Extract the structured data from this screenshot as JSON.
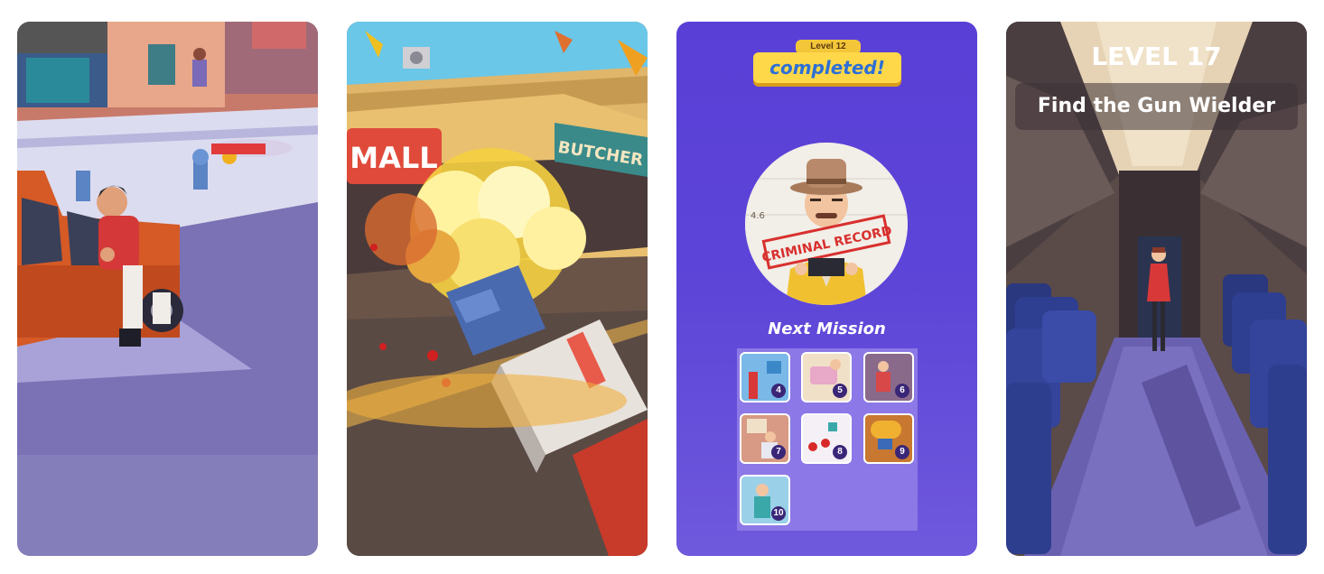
{
  "screens": [
    {
      "kind": "street-scene"
    },
    {
      "kind": "explosion-scene",
      "signs": {
        "mall": "MALL",
        "butcher": "BUTCHER"
      }
    },
    {
      "kind": "mission-complete",
      "level_tag": "Level 12",
      "status": "completed!",
      "stamp_text": "CRIMINAL RECORD",
      "height_mark": "4.6",
      "next_title": "Next Mission",
      "missions": [
        "4",
        "5",
        "6",
        "7",
        "8",
        "9",
        "10"
      ]
    },
    {
      "kind": "airplane-scene",
      "level_title": "LEVEL 17",
      "objective": "Find the Gun Wielder"
    }
  ],
  "colors": {
    "purple_bg": "#5a3fd6",
    "badge": "#ffd84a",
    "badge_text": "#2d6fd6"
  }
}
